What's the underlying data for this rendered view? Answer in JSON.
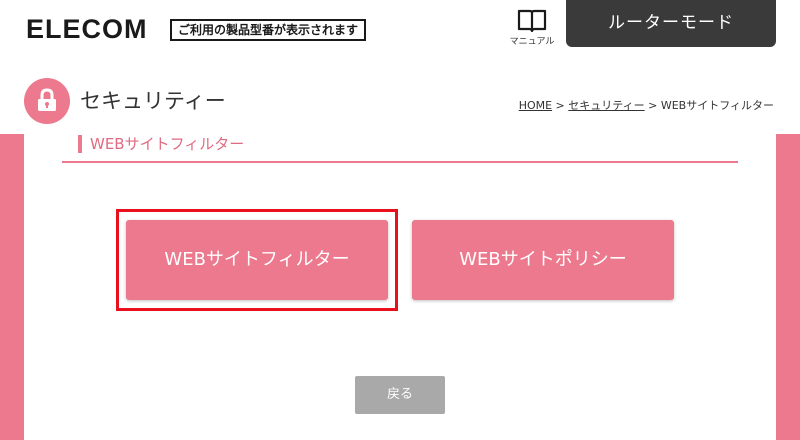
{
  "header": {
    "logo": "ELECOM",
    "model_note": "ご利用の製品型番が表示されます",
    "manual_label": "マニュアル",
    "mode_button": "ルーターモード"
  },
  "title": {
    "icon": "lock-icon",
    "text": "セキュリティー"
  },
  "breadcrumb": {
    "home": "HOME",
    "sep1": " > ",
    "security": "セキュリティー",
    "sep2": " > ",
    "current": "WEBサイトフィルター"
  },
  "section": {
    "title": "WEBサイトフィルター"
  },
  "buttons": {
    "filter": "WEBサイトフィルター",
    "policy": "WEBサイトポリシー",
    "back": "戻る"
  },
  "colors": {
    "accent": "#ec798d",
    "highlight": "#e8101c",
    "header_dark": "#3a3a3a",
    "back_gray": "#a9a9a9"
  }
}
